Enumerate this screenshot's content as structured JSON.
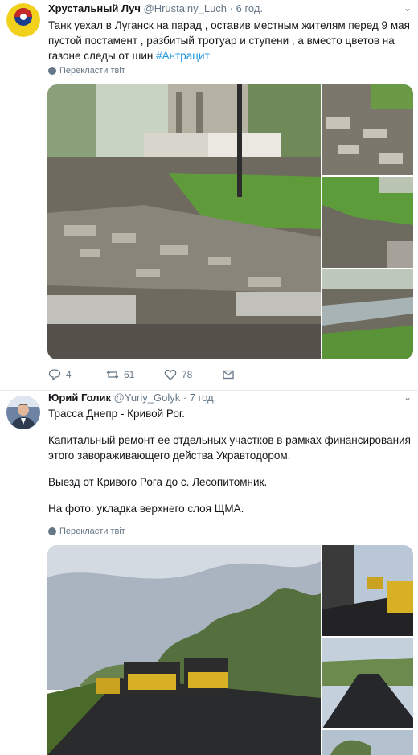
{
  "tweets": [
    {
      "author_name": "Хрустальный Луч",
      "author_handle": "@Hrustalny_Luch",
      "time": "6 год.",
      "text": "Танк уехал в Луганск на парад , оставив местным жителям перед 9 мая пустой постамент , разбитый тротуар и ступени , а вместо цветов на газоне следы от шин ",
      "hashtag": "#Антрацит",
      "translate_label": "Перекласти твіт",
      "replies": "4",
      "retweets": "61",
      "likes": "78"
    },
    {
      "author_name": "Юрий Голик",
      "author_handle": "@Yuriy_Golyk",
      "time": "7 год.",
      "lines": [
        "Трасса Днепр - Кривой Рог.",
        "Капитальный ремонт ее отдельных участков в рамках финансирования этого завораживающего действа Укравтодором.",
        "Выезд от Кривого Рога до с. Лесопитомник.",
        "На фото: укладка верхнего слоя ЩМА."
      ],
      "translate_label": "Перекласти твіт"
    }
  ],
  "icons": {
    "reply": "reply-icon",
    "retweet": "retweet-icon",
    "like": "like-icon",
    "dm": "message-icon",
    "more": "chevron-down-icon",
    "translate": "globe-icon"
  },
  "colors": {
    "link": "#1b95e0",
    "muted": "#657786",
    "divider": "#e6ecf0"
  }
}
